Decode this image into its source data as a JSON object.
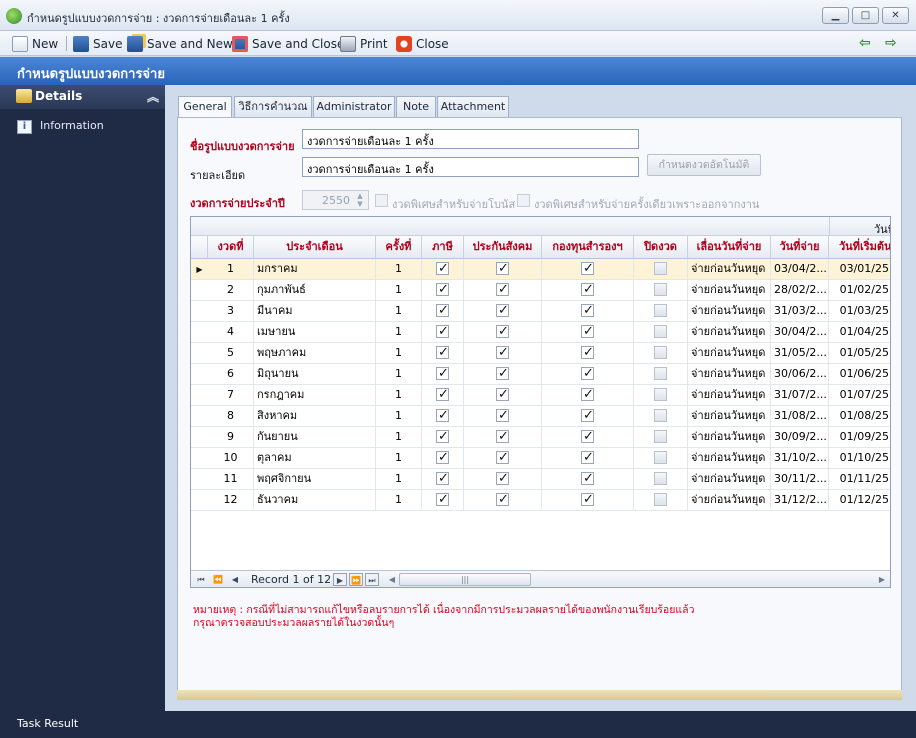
{
  "window": {
    "title": "กำหนดรูปแบบงวดการจ่าย : งวดการจ่ายเดือนละ 1 ครั้ง",
    "min_glyph": "▁",
    "max_glyph": "□",
    "close_glyph": "✕"
  },
  "toolbar": {
    "new_label": "New",
    "save_label": "Save",
    "save_new_label": "Save and New",
    "save_close_label": "Save and Close",
    "print_label": "Print",
    "close_label": "Close",
    "back_glyph": "⇦",
    "forward_glyph": "⇨"
  },
  "section": {
    "title": "กำหนดรูปแบบงวดการจ่าย"
  },
  "sidebar": {
    "group_label": "Details",
    "collapse_glyph": "︽",
    "items": [
      {
        "label": "Information",
        "icon": "info-icon",
        "icon_glyph": "i"
      }
    ]
  },
  "taskbar": {
    "label": "Task Result"
  },
  "tabs": [
    {
      "label": "General",
      "active": true
    },
    {
      "label": "วิธีการคำนวณ",
      "active": false
    },
    {
      "label": "Administrator",
      "active": false
    },
    {
      "label": "Note",
      "active": false
    },
    {
      "label": "Attachment",
      "active": false
    }
  ],
  "form": {
    "format_name_label": "ชื่อรูปแบบงวดการจ่าย",
    "format_name_value": "งวดการจ่ายเดือนละ 1 ครั้ง",
    "detail_label": "รายละเอียด",
    "detail_value": "งวดการจ่ายเดือนละ 1 ครั้ง",
    "auto_button_label": "กำหนดงวดอัตโนมัติ",
    "year_label": "งวดการจ่ายประจำปี",
    "year_value": "2550",
    "bonus_check_label": "งวดพิเศษสำหรับจ่ายโบนัส",
    "resign_check_label": "งวดพิเศษสำหรับจ่ายครั้งเดียวเพราะออกจากงาน"
  },
  "grid": {
    "group_header": "วันที่",
    "columns": [
      "งวดที่",
      "ประจำเดือน",
      "ครั้งที่",
      "ภาษี",
      "ประกันสังคม",
      "กองทุนสำรองฯ",
      "ปิดงวด",
      "เลื่อนวันที่จ่าย",
      "วันที่จ่าย",
      "วันที่เริ่มต้น"
    ],
    "rows": [
      {
        "no": "1",
        "month": "มกราคม",
        "times": "1",
        "tax": true,
        "sso": true,
        "pf": true,
        "closed": false,
        "shift": "จ่ายก่อนวันหยุด",
        "pay_date": "03/04/2...",
        "start_date": "03/01/25"
      },
      {
        "no": "2",
        "month": "กุมภาพันธ์",
        "times": "1",
        "tax": true,
        "sso": true,
        "pf": true,
        "closed": false,
        "shift": "จ่ายก่อนวันหยุด",
        "pay_date": "28/02/2...",
        "start_date": "01/02/25"
      },
      {
        "no": "3",
        "month": "มีนาคม",
        "times": "1",
        "tax": true,
        "sso": true,
        "pf": true,
        "closed": false,
        "shift": "จ่ายก่อนวันหยุด",
        "pay_date": "31/03/2...",
        "start_date": "01/03/25"
      },
      {
        "no": "4",
        "month": "เมษายน",
        "times": "1",
        "tax": true,
        "sso": true,
        "pf": true,
        "closed": false,
        "shift": "จ่ายก่อนวันหยุด",
        "pay_date": "30/04/2...",
        "start_date": "01/04/25"
      },
      {
        "no": "5",
        "month": "พฤษภาคม",
        "times": "1",
        "tax": true,
        "sso": true,
        "pf": true,
        "closed": false,
        "shift": "จ่ายก่อนวันหยุด",
        "pay_date": "31/05/2...",
        "start_date": "01/05/25"
      },
      {
        "no": "6",
        "month": "มิถุนายน",
        "times": "1",
        "tax": true,
        "sso": true,
        "pf": true,
        "closed": false,
        "shift": "จ่ายก่อนวันหยุด",
        "pay_date": "30/06/2...",
        "start_date": "01/06/25"
      },
      {
        "no": "7",
        "month": "กรกฎาคม",
        "times": "1",
        "tax": true,
        "sso": true,
        "pf": true,
        "closed": false,
        "shift": "จ่ายก่อนวันหยุด",
        "pay_date": "31/07/2...",
        "start_date": "01/07/25"
      },
      {
        "no": "8",
        "month": "สิงหาคม",
        "times": "1",
        "tax": true,
        "sso": true,
        "pf": true,
        "closed": false,
        "shift": "จ่ายก่อนวันหยุด",
        "pay_date": "31/08/2...",
        "start_date": "01/08/25"
      },
      {
        "no": "9",
        "month": "กันยายน",
        "times": "1",
        "tax": true,
        "sso": true,
        "pf": true,
        "closed": false,
        "shift": "จ่ายก่อนวันหยุด",
        "pay_date": "30/09/2...",
        "start_date": "01/09/25"
      },
      {
        "no": "10",
        "month": "ตุลาคม",
        "times": "1",
        "tax": true,
        "sso": true,
        "pf": true,
        "closed": false,
        "shift": "จ่ายก่อนวันหยุด",
        "pay_date": "31/10/2...",
        "start_date": "01/10/25"
      },
      {
        "no": "11",
        "month": "พฤศจิกายน",
        "times": "1",
        "tax": true,
        "sso": true,
        "pf": true,
        "closed": false,
        "shift": "จ่ายก่อนวันหยุด",
        "pay_date": "30/11/2...",
        "start_date": "01/11/25"
      },
      {
        "no": "12",
        "month": "ธันวาคม",
        "times": "1",
        "tax": true,
        "sso": true,
        "pf": true,
        "closed": false,
        "shift": "จ่ายก่อนวันหยุด",
        "pay_date": "31/12/2...",
        "start_date": "01/12/25"
      }
    ],
    "navigator": {
      "record_text": "Record 1 of 12",
      "first_glyph": "⏮",
      "prev_page_glyph": "⏪",
      "prev_glyph": "◀",
      "next_glyph": "▶",
      "next_page_glyph": "⏩",
      "last_glyph": "⏭",
      "scroll_left_glyph": "◀",
      "scroll_right_glyph": "▶",
      "thumb_grip": "|||"
    },
    "row_pointer_glyph": "▶"
  },
  "note": {
    "line1": "หมายเหตุ : กรณีที่ไม่สามารถแก้ไขหรือลบรายการได้ เนื่องจากมีการประมวลผลรายได้ของพนักงานเรียบร้อยแล้ว",
    "line2": "กรุณาตรวจสอบประมวลผลรายได้ในงวดนั้นๆ"
  },
  "colors": {
    "accent": "#2a63b8",
    "required_label": "#b1001c",
    "note_text": "#e0001e",
    "sidebar_bg": "#1f2a44",
    "selected_row": "#fdf3d7"
  }
}
